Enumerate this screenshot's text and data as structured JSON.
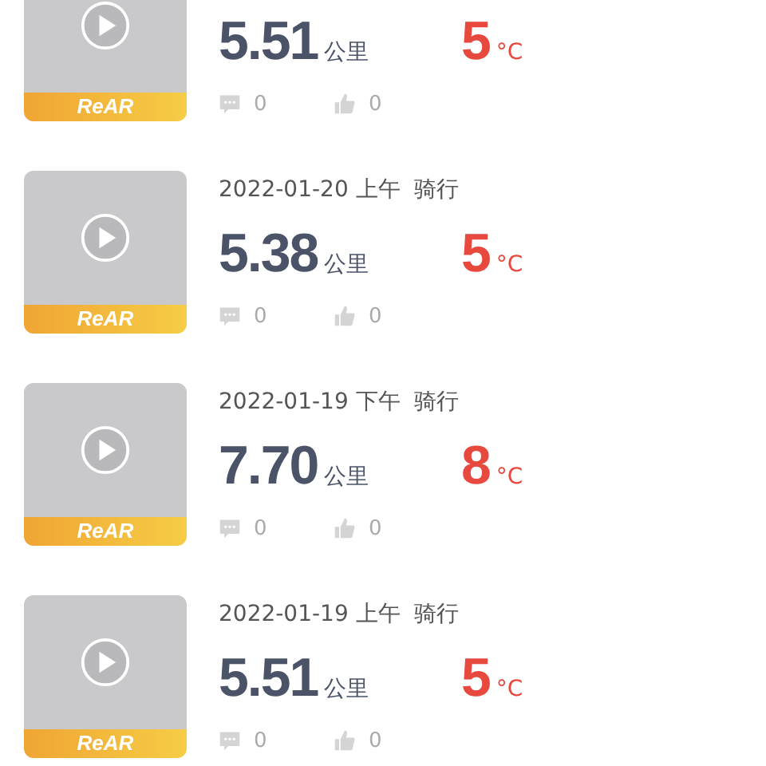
{
  "rides": [
    {
      "distance": "5.51",
      "unit": "公里",
      "temperature": "5",
      "temp_unit": "°C",
      "badge": "ReAR",
      "comments": "0",
      "likes": "0"
    },
    {
      "date": "2022-01-20 上午  骑行",
      "distance": "5.38",
      "unit": "公里",
      "temperature": "5",
      "temp_unit": "°C",
      "badge": "ReAR",
      "comments": "0",
      "likes": "0"
    },
    {
      "date": "2022-01-19 下午  骑行",
      "distance": "7.70",
      "unit": "公里",
      "temperature": "8",
      "temp_unit": "°C",
      "badge": "ReAR",
      "comments": "0",
      "likes": "0"
    },
    {
      "date": "2022-01-19 上午  骑行",
      "distance": "5.51",
      "unit": "公里",
      "temperature": "5",
      "temp_unit": "°C",
      "badge": "ReAR",
      "comments": "0",
      "likes": "0"
    }
  ]
}
